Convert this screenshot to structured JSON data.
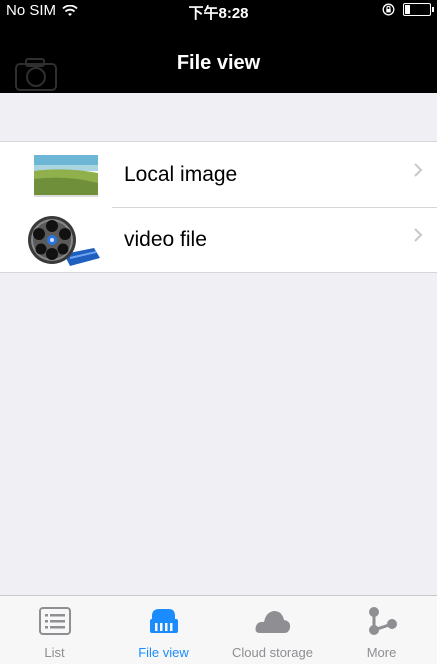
{
  "status_bar": {
    "carrier": "No SIM",
    "time": "下午8:28",
    "battery_level": 0.2
  },
  "nav": {
    "title": "File view"
  },
  "list": {
    "items": [
      {
        "label": "Local image",
        "icon": "landscape-thumbnail-icon"
      },
      {
        "label": "video file",
        "icon": "film-reel-icon"
      }
    ]
  },
  "tab_bar": {
    "active_color": "#1a8cff",
    "inactive_color": "#8e8e93",
    "tabs": [
      {
        "label": "List",
        "icon": "list-icon"
      },
      {
        "label": "File view",
        "icon": "folder-file-icon",
        "active": true
      },
      {
        "label": "Cloud storage",
        "icon": "cloud-icon"
      },
      {
        "label": "More",
        "icon": "more-share-icon"
      }
    ]
  }
}
